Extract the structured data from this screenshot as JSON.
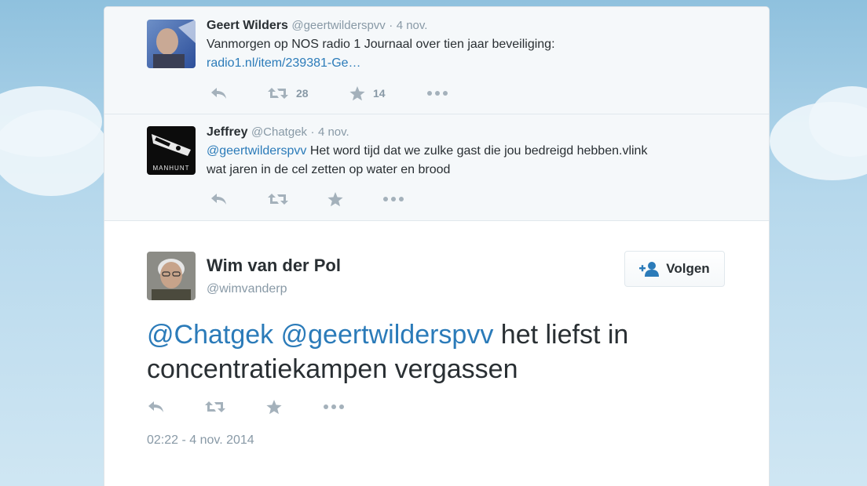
{
  "conversation": [
    {
      "name": "Geert Wilders",
      "handle": "@geertwilderspvv",
      "dot": "·",
      "date": "4 nov.",
      "text": "Vanmorgen op NOS radio 1 Journaal over tien jaar beveiliging:",
      "link": "radio1.nl/item/239381-Ge…",
      "retweets": "28",
      "favorites": "14",
      "avatar_icon": "portrait-photo-icon"
    },
    {
      "name": "Jeffrey",
      "handle": "@Chatgek",
      "dot": "·",
      "date": "4 nov.",
      "mention": "@geertwilderspvv",
      "text_line1": " Het word tijd dat we zulke gast die jou bedreigd hebben.vlink",
      "text_line2": "wat jaren in de cel zetten op water en brood",
      "avatar_icon": "manhunt-logo-icon",
      "avatar_label": "MANHUNT"
    }
  ],
  "main_tweet": {
    "name": "Wim van der Pol",
    "handle": "@wimvanderp",
    "follow_label": "Volgen",
    "mention1": "@Chatgek",
    "mention2": "@geertwilderspvv",
    "text_rest_line1": " het liefst in",
    "text_line2": "concentratiekampen vergassen",
    "timestamp": "02:22 - 4 nov. 2014",
    "avatar_icon": "portrait-photo-icon"
  },
  "colors": {
    "link": "#2b7bb9",
    "muted": "#8899a6",
    "icon": "#a4b1bb",
    "text": "#292f33",
    "background_sky": "#a9cfe6"
  },
  "icons": {
    "reply": "reply-icon",
    "retweet": "retweet-icon",
    "favorite": "star-icon",
    "more": "more-icon",
    "follow": "add-user-icon"
  }
}
